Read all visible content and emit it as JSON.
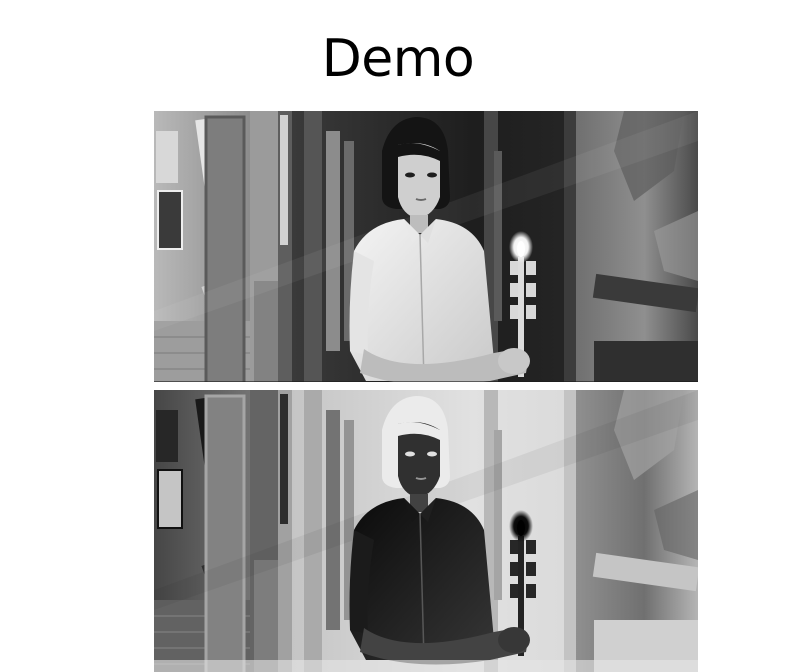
{
  "page": {
    "title": "Demo"
  },
  "images": [
    {
      "variant": "original"
    },
    {
      "variant": "inverted"
    }
  ]
}
